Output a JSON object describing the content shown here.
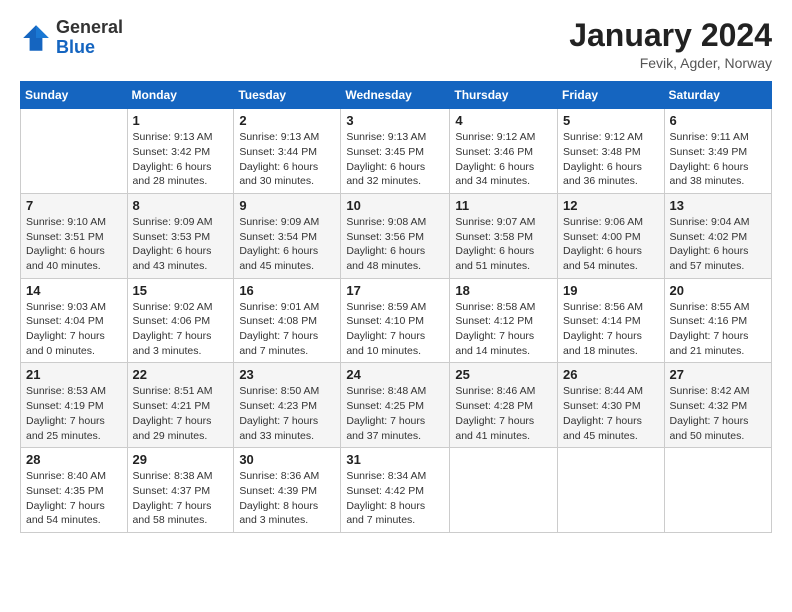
{
  "header": {
    "logo_general": "General",
    "logo_blue": "Blue",
    "month_title": "January 2024",
    "location": "Fevik, Agder, Norway"
  },
  "days_of_week": [
    "Sunday",
    "Monday",
    "Tuesday",
    "Wednesday",
    "Thursday",
    "Friday",
    "Saturday"
  ],
  "weeks": [
    [
      {
        "day": "",
        "info": ""
      },
      {
        "day": "1",
        "info": "Sunrise: 9:13 AM\nSunset: 3:42 PM\nDaylight: 6 hours\nand 28 minutes."
      },
      {
        "day": "2",
        "info": "Sunrise: 9:13 AM\nSunset: 3:44 PM\nDaylight: 6 hours\nand 30 minutes."
      },
      {
        "day": "3",
        "info": "Sunrise: 9:13 AM\nSunset: 3:45 PM\nDaylight: 6 hours\nand 32 minutes."
      },
      {
        "day": "4",
        "info": "Sunrise: 9:12 AM\nSunset: 3:46 PM\nDaylight: 6 hours\nand 34 minutes."
      },
      {
        "day": "5",
        "info": "Sunrise: 9:12 AM\nSunset: 3:48 PM\nDaylight: 6 hours\nand 36 minutes."
      },
      {
        "day": "6",
        "info": "Sunrise: 9:11 AM\nSunset: 3:49 PM\nDaylight: 6 hours\nand 38 minutes."
      }
    ],
    [
      {
        "day": "7",
        "info": "Sunrise: 9:10 AM\nSunset: 3:51 PM\nDaylight: 6 hours\nand 40 minutes."
      },
      {
        "day": "8",
        "info": "Sunrise: 9:09 AM\nSunset: 3:53 PM\nDaylight: 6 hours\nand 43 minutes."
      },
      {
        "day": "9",
        "info": "Sunrise: 9:09 AM\nSunset: 3:54 PM\nDaylight: 6 hours\nand 45 minutes."
      },
      {
        "day": "10",
        "info": "Sunrise: 9:08 AM\nSunset: 3:56 PM\nDaylight: 6 hours\nand 48 minutes."
      },
      {
        "day": "11",
        "info": "Sunrise: 9:07 AM\nSunset: 3:58 PM\nDaylight: 6 hours\nand 51 minutes."
      },
      {
        "day": "12",
        "info": "Sunrise: 9:06 AM\nSunset: 4:00 PM\nDaylight: 6 hours\nand 54 minutes."
      },
      {
        "day": "13",
        "info": "Sunrise: 9:04 AM\nSunset: 4:02 PM\nDaylight: 6 hours\nand 57 minutes."
      }
    ],
    [
      {
        "day": "14",
        "info": "Sunrise: 9:03 AM\nSunset: 4:04 PM\nDaylight: 7 hours\nand 0 minutes."
      },
      {
        "day": "15",
        "info": "Sunrise: 9:02 AM\nSunset: 4:06 PM\nDaylight: 7 hours\nand 3 minutes."
      },
      {
        "day": "16",
        "info": "Sunrise: 9:01 AM\nSunset: 4:08 PM\nDaylight: 7 hours\nand 7 minutes."
      },
      {
        "day": "17",
        "info": "Sunrise: 8:59 AM\nSunset: 4:10 PM\nDaylight: 7 hours\nand 10 minutes."
      },
      {
        "day": "18",
        "info": "Sunrise: 8:58 AM\nSunset: 4:12 PM\nDaylight: 7 hours\nand 14 minutes."
      },
      {
        "day": "19",
        "info": "Sunrise: 8:56 AM\nSunset: 4:14 PM\nDaylight: 7 hours\nand 18 minutes."
      },
      {
        "day": "20",
        "info": "Sunrise: 8:55 AM\nSunset: 4:16 PM\nDaylight: 7 hours\nand 21 minutes."
      }
    ],
    [
      {
        "day": "21",
        "info": "Sunrise: 8:53 AM\nSunset: 4:19 PM\nDaylight: 7 hours\nand 25 minutes."
      },
      {
        "day": "22",
        "info": "Sunrise: 8:51 AM\nSunset: 4:21 PM\nDaylight: 7 hours\nand 29 minutes."
      },
      {
        "day": "23",
        "info": "Sunrise: 8:50 AM\nSunset: 4:23 PM\nDaylight: 7 hours\nand 33 minutes."
      },
      {
        "day": "24",
        "info": "Sunrise: 8:48 AM\nSunset: 4:25 PM\nDaylight: 7 hours\nand 37 minutes."
      },
      {
        "day": "25",
        "info": "Sunrise: 8:46 AM\nSunset: 4:28 PM\nDaylight: 7 hours\nand 41 minutes."
      },
      {
        "day": "26",
        "info": "Sunrise: 8:44 AM\nSunset: 4:30 PM\nDaylight: 7 hours\nand 45 minutes."
      },
      {
        "day": "27",
        "info": "Sunrise: 8:42 AM\nSunset: 4:32 PM\nDaylight: 7 hours\nand 50 minutes."
      }
    ],
    [
      {
        "day": "28",
        "info": "Sunrise: 8:40 AM\nSunset: 4:35 PM\nDaylight: 7 hours\nand 54 minutes."
      },
      {
        "day": "29",
        "info": "Sunrise: 8:38 AM\nSunset: 4:37 PM\nDaylight: 7 hours\nand 58 minutes."
      },
      {
        "day": "30",
        "info": "Sunrise: 8:36 AM\nSunset: 4:39 PM\nDaylight: 8 hours\nand 3 minutes."
      },
      {
        "day": "31",
        "info": "Sunrise: 8:34 AM\nSunset: 4:42 PM\nDaylight: 8 hours\nand 7 minutes."
      },
      {
        "day": "",
        "info": ""
      },
      {
        "day": "",
        "info": ""
      },
      {
        "day": "",
        "info": ""
      }
    ]
  ]
}
